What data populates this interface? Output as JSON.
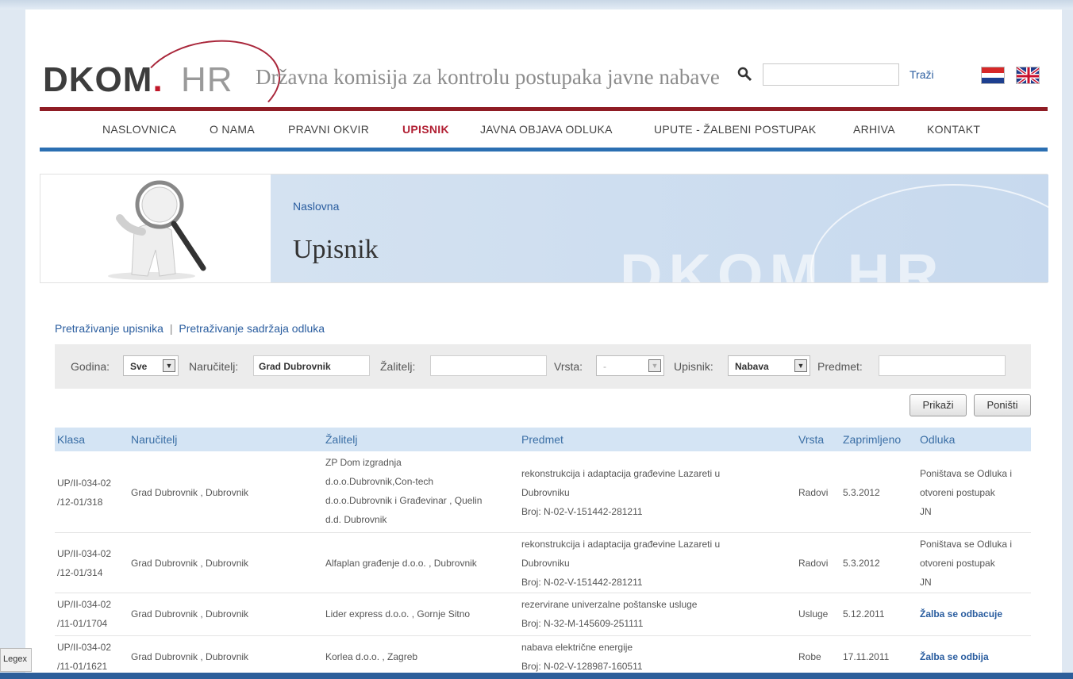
{
  "header": {
    "logo_main": "DKOM",
    "logo_dot": ".",
    "logo_suffix": "HR",
    "tagline": "Državna komisija za kontrolu postupaka javne nabave",
    "search_value": "",
    "search_button": "Traži"
  },
  "nav": {
    "items": [
      "NASLOVNICA",
      "O NAMA",
      "PRAVNI OKVIR",
      "UPISNIK",
      "JAVNA OBJAVA ODLUKA",
      "UPUTE - ŽALBENI POSTUPAK",
      "ARHIVA",
      "KONTAKT"
    ],
    "active": "UPISNIK"
  },
  "banner": {
    "breadcrumb": "Naslovna",
    "title": "Upisnik",
    "watermark": "DKOM.HR"
  },
  "links": {
    "search_register": "Pretraživanje upisnika",
    "separator": "|",
    "search_content": "Pretraživanje sadržaja odluka"
  },
  "filter": {
    "godina_label": "Godina:",
    "godina_value": "Sve",
    "narucitelj_label": "Naručitelj:",
    "narucitelj_value": "Grad Dubrovnik",
    "zalitelj_label": "Žalitelj:",
    "zalitelj_value": "",
    "vrsta_label": "Vrsta:",
    "vrsta_value": "-",
    "upisnik_label": "Upisnik:",
    "upisnik_value": "Nabava",
    "predmet_label": "Predmet:",
    "predmet_value": ""
  },
  "buttons": {
    "show": "Prikaži",
    "reset": "Poništi"
  },
  "table": {
    "headers": [
      "Klasa",
      "Naručitelj",
      "Žalitelj",
      "Predmet",
      "Vrsta",
      "Zaprimljeno",
      "Odluka"
    ],
    "rows": [
      {
        "klasa": [
          "UP/II-034-02",
          "/12-01/318"
        ],
        "narucitelj": "Grad Dubrovnik , Dubrovnik",
        "zalitelj": [
          "ZP Dom izgradnja",
          "d.o.o.Dubrovnik,Con-tech",
          "d.o.o.Dubrovnik i Građevinar , Quelin",
          "d.d. Dubrovnik"
        ],
        "predmet": [
          "rekonstrukcija i adaptacija građevine Lazareti u",
          "Dubrovniku",
          "Broj: N-02-V-151442-281211"
        ],
        "vrsta": "Radovi",
        "zaprimljeno": "5.3.2012",
        "odluka": [
          "Poništava se Odluka i",
          "otvoreni postupak",
          "JN"
        ]
      },
      {
        "klasa": [
          "UP/II-034-02",
          "/12-01/314"
        ],
        "narucitelj": "Grad Dubrovnik , Dubrovnik",
        "zalitelj": [
          "Alfaplan građenje d.o.o. , Dubrovnik"
        ],
        "predmet": [
          "rekonstrukcija i adaptacija građevine Lazareti u",
          "Dubrovniku",
          "Broj: N-02-V-151442-281211"
        ],
        "vrsta": "Radovi",
        "zaprimljeno": "5.3.2012",
        "odluka": [
          "Poništava se Odluka i",
          "otvoreni postupak",
          "JN"
        ]
      },
      {
        "klasa": [
          "UP/II-034-02",
          "/11-01/1704"
        ],
        "narucitelj": "Grad Dubrovnik , Dubrovnik",
        "zalitelj": [
          "Lider express d.o.o. , Gornje Sitno"
        ],
        "predmet": [
          "rezervirane univerzalne poštanske usluge",
          "Broj: N-32-M-145609-251111"
        ],
        "vrsta": "Usluge",
        "zaprimljeno": "5.12.2011",
        "odluka": [
          "Žalba se odbacuje"
        ]
      },
      {
        "klasa": [
          "UP/II-034-02",
          "/11-01/1621"
        ],
        "narucitelj": "Grad Dubrovnik , Dubrovnik",
        "zalitelj": [
          "Korlea d.o.o. , Zagreb"
        ],
        "predmet": [
          "nabava električne energije",
          "Broj: N-02-V-128987-160511"
        ],
        "vrsta": "Robe",
        "zaprimljeno": "17.11.2011",
        "odluka": [
          "Žalba se odbija"
        ]
      }
    ]
  },
  "status_tab": "Legex",
  "colors": {
    "brand_red": "#8f1c24",
    "nav_blue": "#2b6fb2",
    "link_blue": "#2a5d9f",
    "header_row": "#d4e4f4"
  }
}
